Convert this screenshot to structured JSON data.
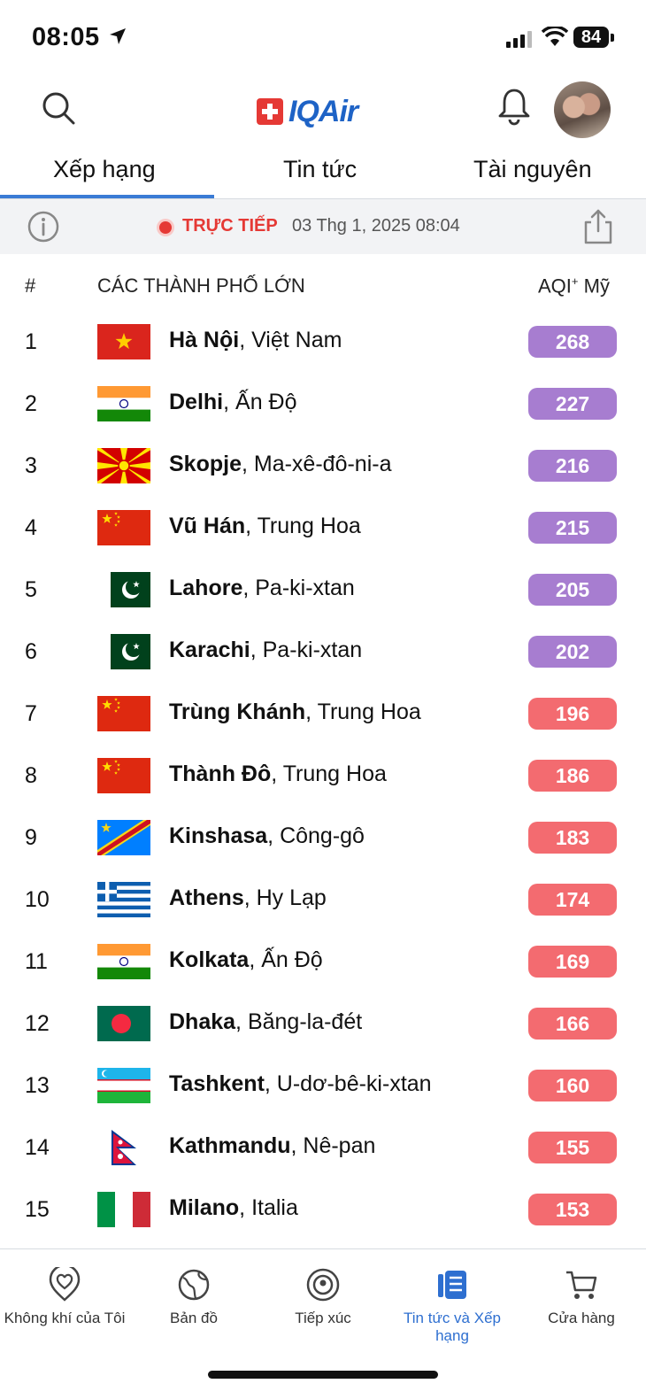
{
  "status_bar": {
    "time": "08:05",
    "battery": "84"
  },
  "header": {
    "logo_text": "IQAir"
  },
  "tabs": [
    {
      "label": "Xếp hạng",
      "active": true
    },
    {
      "label": "Tin tức",
      "active": false
    },
    {
      "label": "Tài nguyên",
      "active": false
    }
  ],
  "live": {
    "label": "TRỰC TIẾP",
    "datetime": "03 Thg 1, 2025 08:04"
  },
  "columns": {
    "rank": "#",
    "city": "CÁC THÀNH PHỐ LỚN",
    "aqi": "AQI",
    "aqi_sup": "+",
    "aqi_suffix": " Mỹ"
  },
  "colors": {
    "unhealthy_very": "#a77dd0",
    "unhealthy": "#f36b70",
    "accent": "#2e6fd0",
    "live": "#e53935"
  },
  "rankings": [
    {
      "rank": "1",
      "city": "Hà Nội",
      "country": ", Việt Nam",
      "aqi": "268",
      "flag": "vietnam-flag-icon",
      "level": "very-unhealthy"
    },
    {
      "rank": "2",
      "city": "Delhi",
      "country": ", Ấn Độ",
      "aqi": "227",
      "flag": "india-flag-icon",
      "level": "very-unhealthy"
    },
    {
      "rank": "3",
      "city": "Skopje",
      "country": ", Ma-xê-đô-ni-a",
      "aqi": "216",
      "flag": "north-macedonia-flag-icon",
      "level": "very-unhealthy"
    },
    {
      "rank": "4",
      "city": "Vũ Hán",
      "country": ", Trung Hoa",
      "aqi": "215",
      "flag": "china-flag-icon",
      "level": "very-unhealthy"
    },
    {
      "rank": "5",
      "city": "Lahore",
      "country": ", Pa-ki-xtan",
      "aqi": "205",
      "flag": "pakistan-flag-icon",
      "level": "very-unhealthy"
    },
    {
      "rank": "6",
      "city": "Karachi",
      "country": ", Pa-ki-xtan",
      "aqi": "202",
      "flag": "pakistan-flag-icon",
      "level": "very-unhealthy"
    },
    {
      "rank": "7",
      "city": "Trùng Khánh",
      "country": ", Trung Hoa",
      "aqi": "196",
      "flag": "china-flag-icon",
      "level": "unhealthy"
    },
    {
      "rank": "8",
      "city": "Thành Đô",
      "country": ", Trung Hoa",
      "aqi": "186",
      "flag": "china-flag-icon",
      "level": "unhealthy"
    },
    {
      "rank": "9",
      "city": "Kinshasa",
      "country": ", Công-gô",
      "aqi": "183",
      "flag": "dr-congo-flag-icon",
      "level": "unhealthy"
    },
    {
      "rank": "10",
      "city": "Athens",
      "country": ", Hy Lạp",
      "aqi": "174",
      "flag": "greece-flag-icon",
      "level": "unhealthy"
    },
    {
      "rank": "11",
      "city": "Kolkata",
      "country": ", Ấn Độ",
      "aqi": "169",
      "flag": "india-flag-icon",
      "level": "unhealthy"
    },
    {
      "rank": "12",
      "city": "Dhaka",
      "country": ", Băng-la-đét",
      "aqi": "166",
      "flag": "bangladesh-flag-icon",
      "level": "unhealthy"
    },
    {
      "rank": "13",
      "city": "Tashkent",
      "country": ", U-dơ-bê-ki-xtan",
      "aqi": "160",
      "flag": "uzbekistan-flag-icon",
      "level": "unhealthy"
    },
    {
      "rank": "14",
      "city": "Kathmandu",
      "country": ", Nê-pan",
      "aqi": "155",
      "flag": "nepal-flag-icon",
      "level": "unhealthy"
    },
    {
      "rank": "15",
      "city": "Milano",
      "country": ", Italia",
      "aqi": "153",
      "flag": "italy-flag-icon",
      "level": "unhealthy"
    }
  ],
  "bottom_nav": [
    {
      "label": "Không khí của Tôi",
      "icon": "heart-location-icon",
      "active": false
    },
    {
      "label": "Bản đồ",
      "icon": "globe-icon",
      "active": false
    },
    {
      "label": "Tiếp xúc",
      "icon": "exposure-icon",
      "active": false
    },
    {
      "label": "Tin tức và Xếp hạng",
      "icon": "news-icon",
      "active": true
    },
    {
      "label": "Cửa hàng",
      "icon": "cart-icon",
      "active": false
    }
  ]
}
